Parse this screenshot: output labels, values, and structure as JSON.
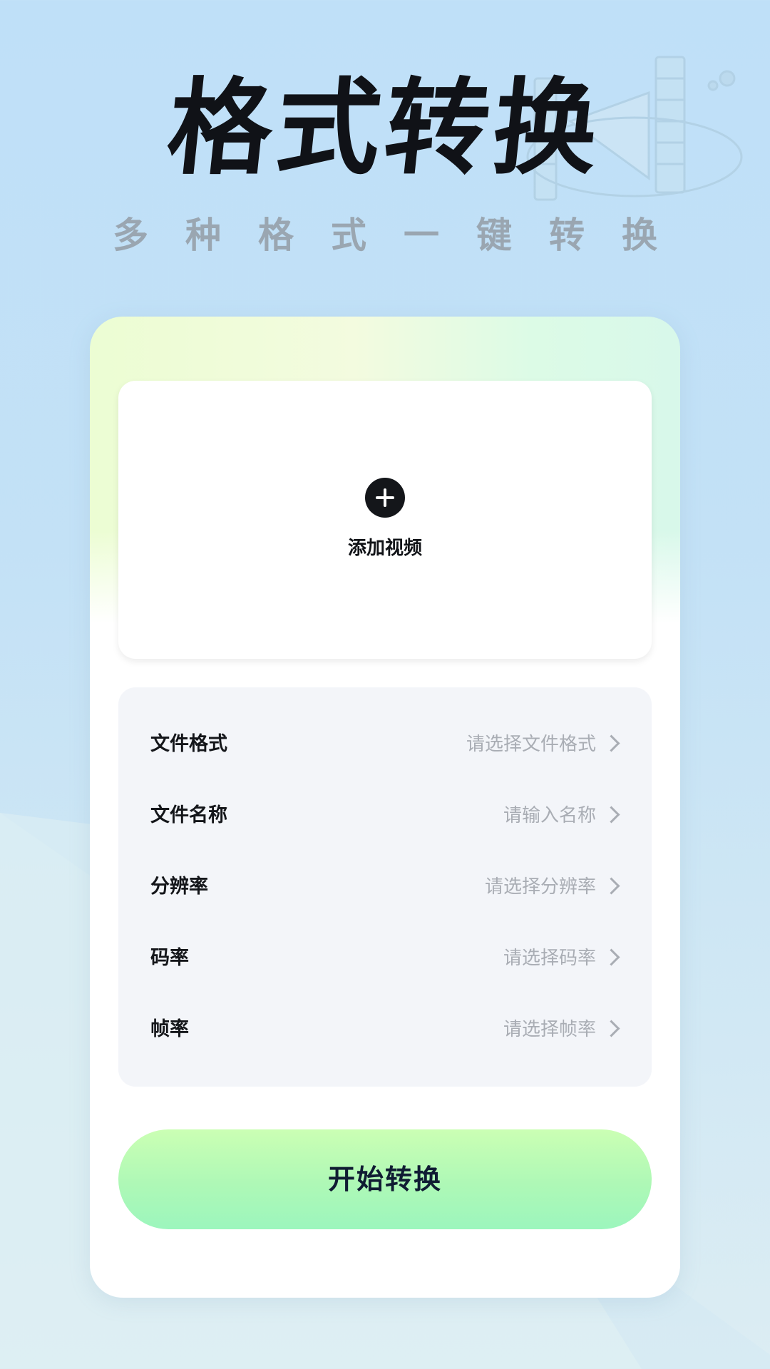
{
  "header": {
    "title": "格式转换",
    "subtitle": "多种格式一键转换"
  },
  "upload": {
    "label": "添加视频",
    "icon": "plus-circle-icon"
  },
  "settings": {
    "rows": [
      {
        "label": "文件格式",
        "placeholder": "请选择文件格式"
      },
      {
        "label": "文件名称",
        "placeholder": "请输入名称"
      },
      {
        "label": "分辨率",
        "placeholder": "请选择分辨率"
      },
      {
        "label": "码率",
        "placeholder": "请选择码率"
      },
      {
        "label": "帧率",
        "placeholder": "请选择帧率"
      }
    ]
  },
  "actions": {
    "start_label": "开始转换"
  },
  "colors": {
    "background": "#c3e1f6",
    "title": "#101217",
    "subtitle": "#9aa6b1",
    "button_gradient_top": "#cbffb4",
    "button_gradient_bottom": "#9cf6bd",
    "placeholder": "#a9adb4"
  }
}
